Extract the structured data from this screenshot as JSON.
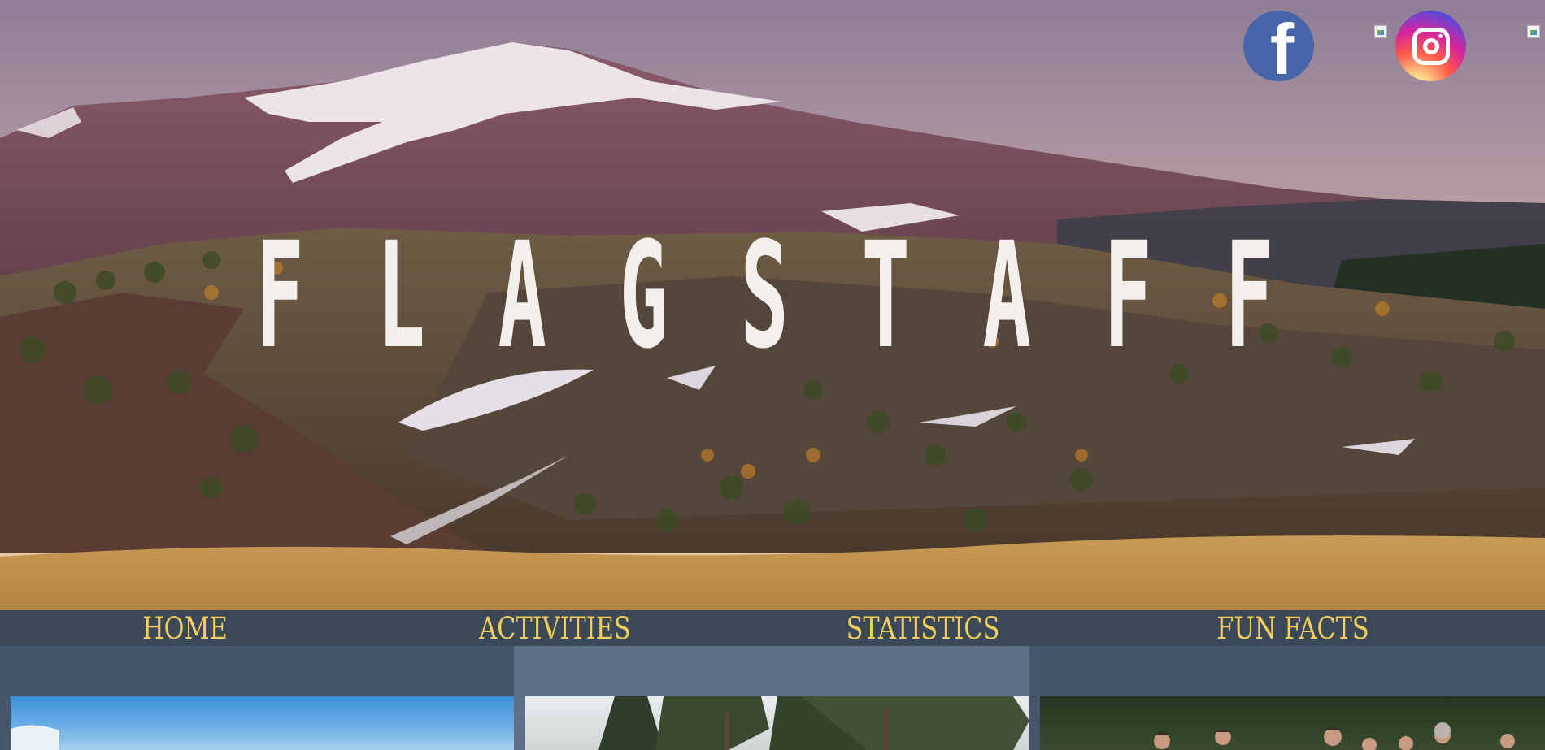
{
  "hero": {
    "title_letters": [
      "F",
      "L",
      "A",
      "G",
      "S",
      "T",
      "A",
      "F",
      "F"
    ]
  },
  "social": {
    "facebook": {
      "icon": "facebook-icon",
      "glyph": "f",
      "color": "#4664a8"
    },
    "instagram": {
      "icon": "instagram-icon"
    }
  },
  "nav": {
    "items": [
      {
        "label": "HOME"
      },
      {
        "label": "ACTIVITIES"
      },
      {
        "label": "STATISTICS"
      },
      {
        "label": "FUN FACTS"
      }
    ],
    "text_color": "#f2cf5a",
    "background": "#3a4858"
  },
  "cards": {
    "highlight_color": "#5d7088",
    "base_color": "#46566a"
  }
}
